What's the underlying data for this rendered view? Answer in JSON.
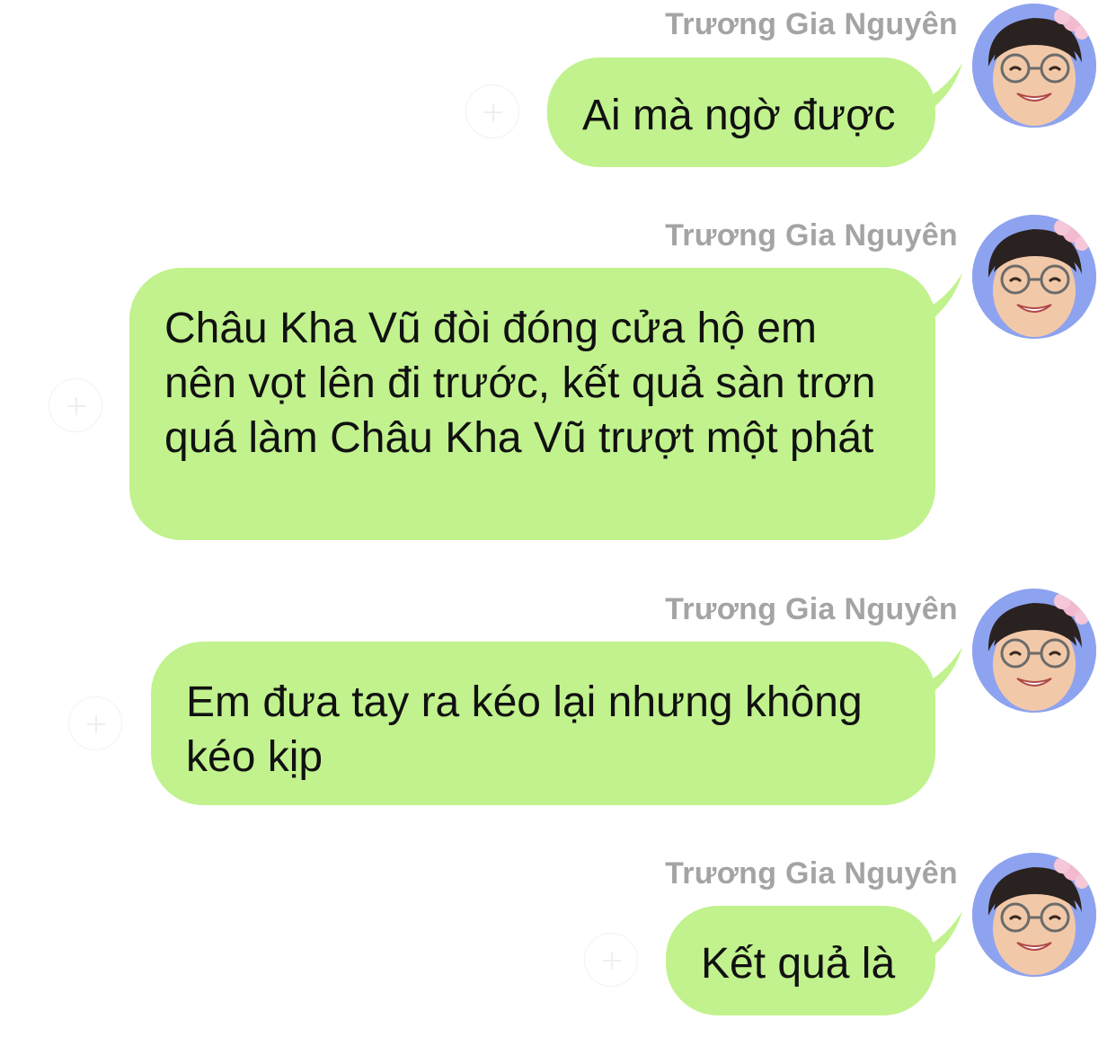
{
  "conversation": {
    "messages": [
      {
        "sender": "Trương Gia Nguyên",
        "text": "Ai mà ngờ được"
      },
      {
        "sender": "Trương Gia Nguyên",
        "text": "Châu Kha Vũ đòi đóng cửa hộ em nên vọt lên đi trước, kết quả sàn trơn quá làm Châu Kha Vũ trượt một phát"
      },
      {
        "sender": "Trương Gia Nguyên",
        "text": "Em đưa tay ra kéo lại nhưng không kéo kịp"
      },
      {
        "sender": "Trương Gia Nguyên",
        "text": "Kết quả là"
      }
    ]
  },
  "colors": {
    "bubble": "#c1f28d",
    "sender_name": "#a4a4a4",
    "avatar_background": "#8ea3ef",
    "page_background": "#ffffff"
  },
  "icons": {
    "avatar": "avatar-photo",
    "reaction": "add-reaction-icon"
  }
}
